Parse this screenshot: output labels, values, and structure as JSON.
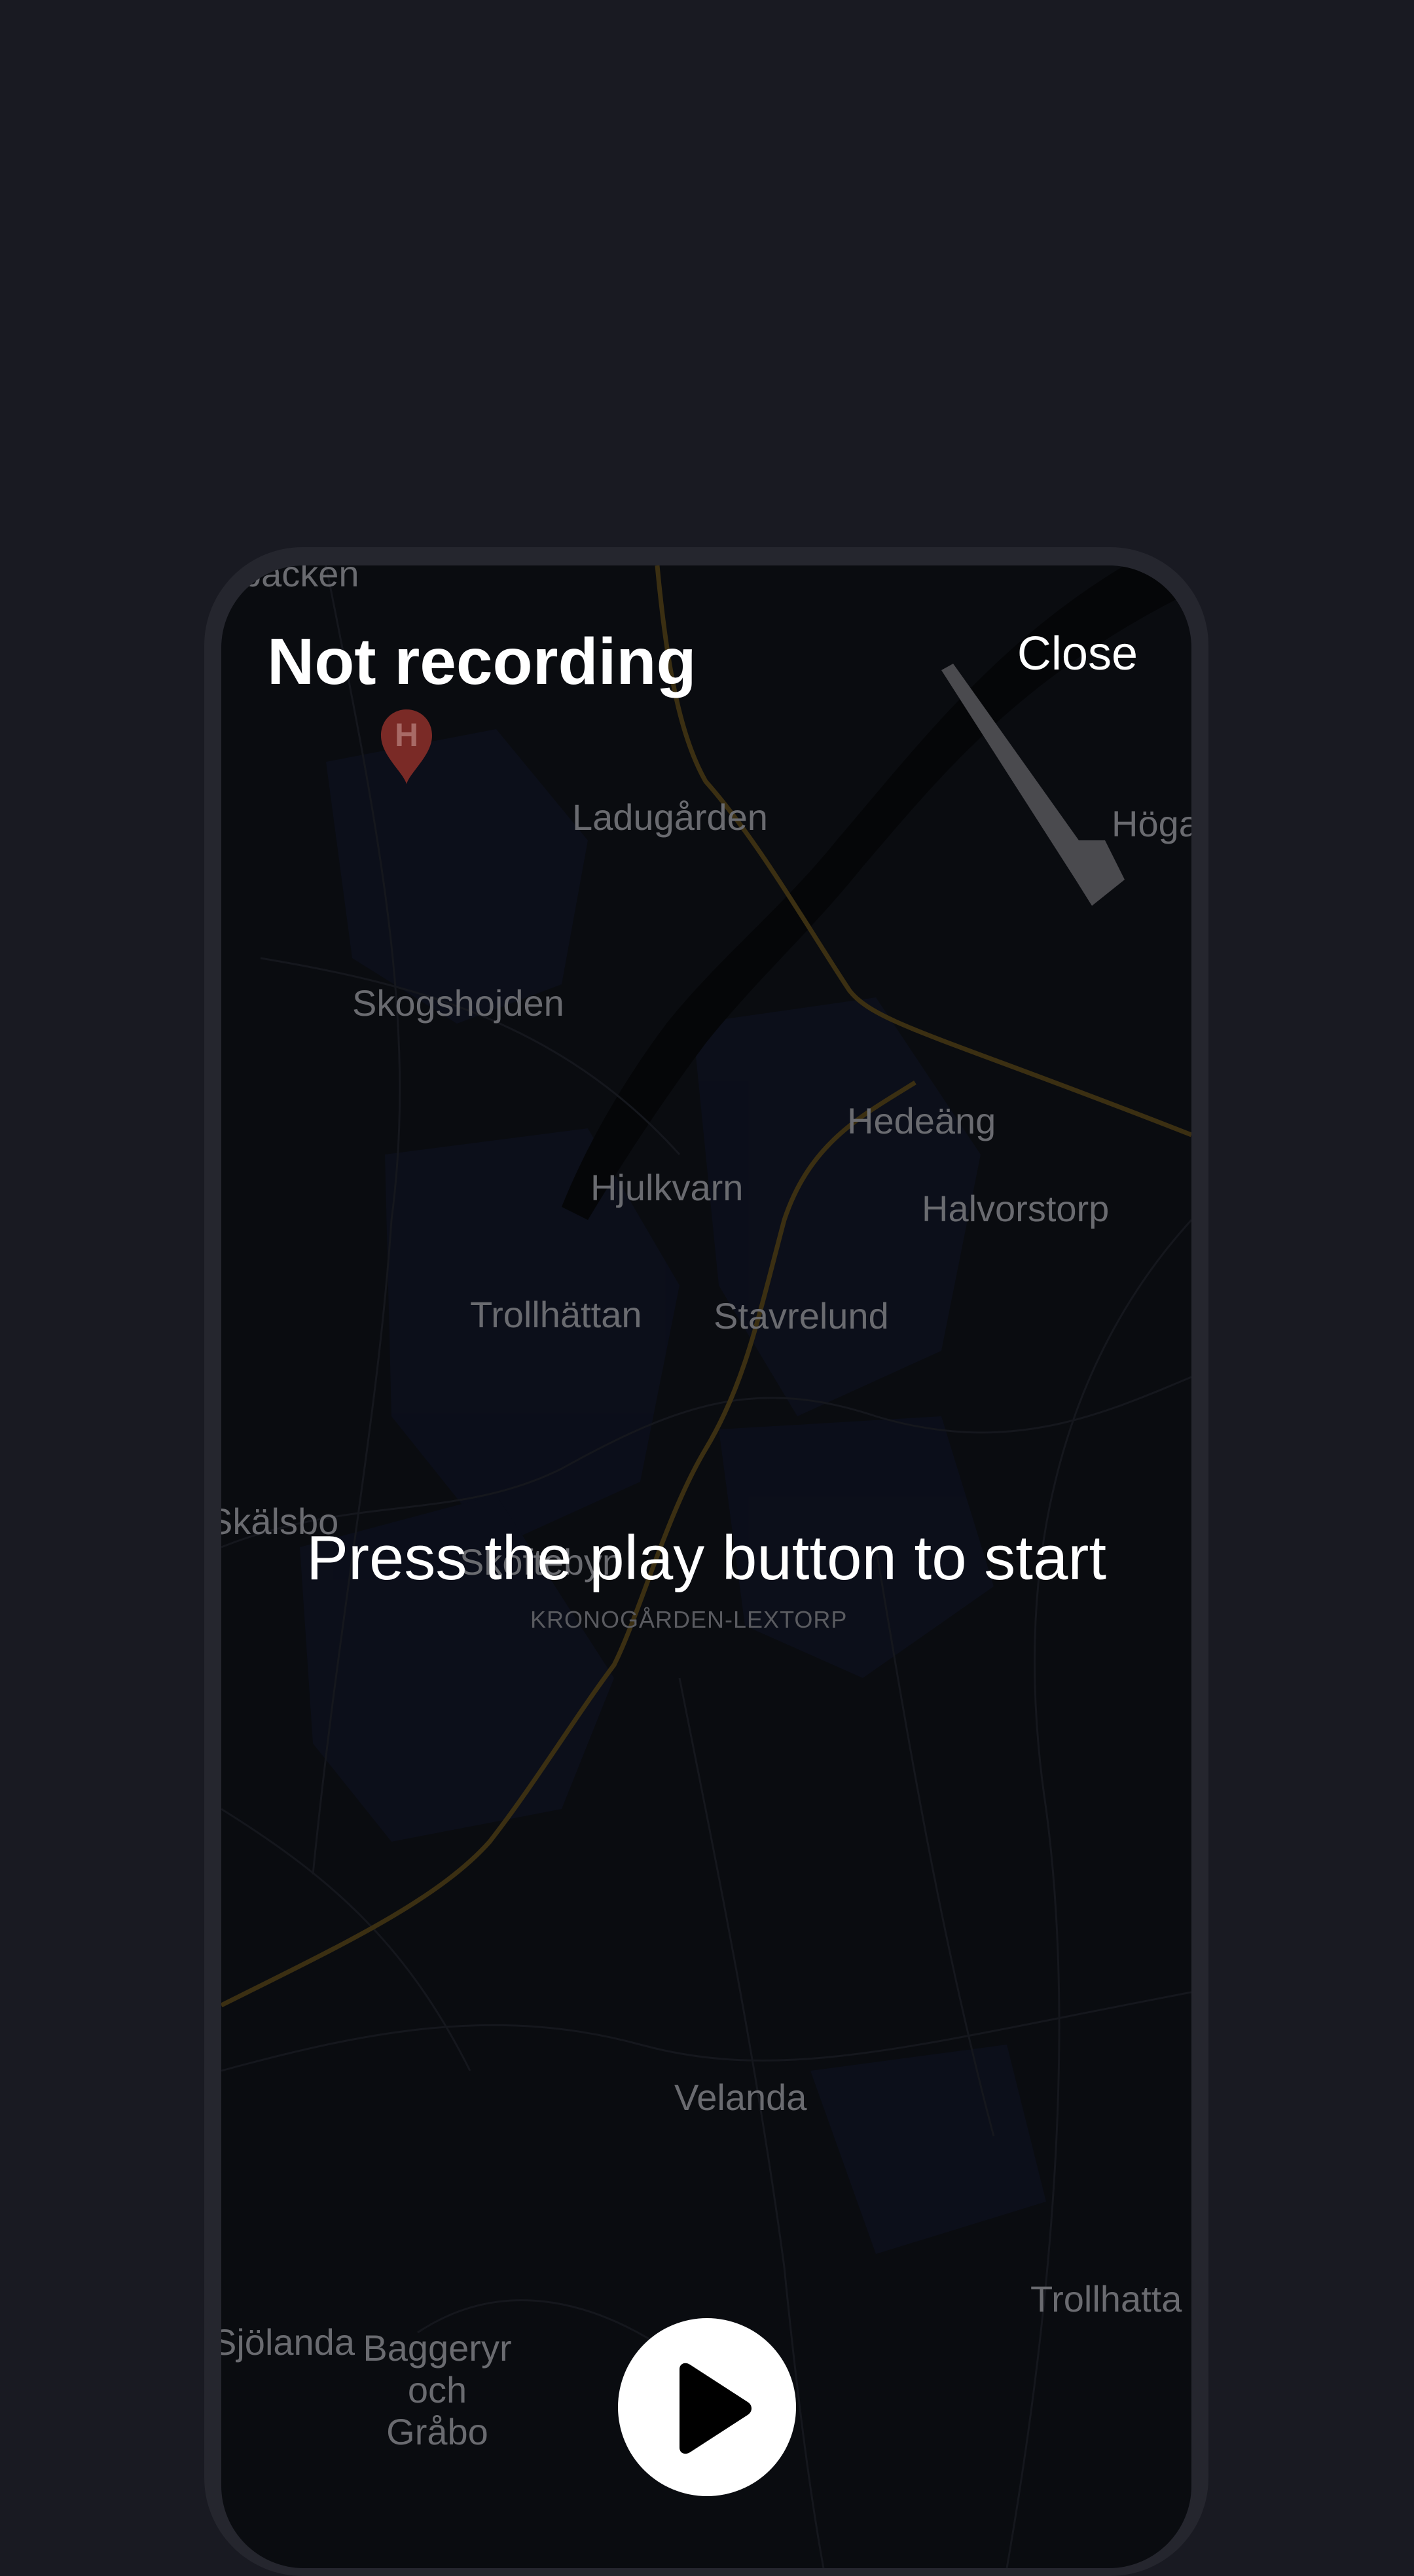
{
  "header": {
    "title": "Not recording",
    "close_label": "Close"
  },
  "hint": "Press the play button to start",
  "play_button": {
    "icon": "play-icon"
  },
  "map": {
    "places": {
      "backen": "backen",
      "ladugarden": "Ladugården",
      "hoga": "Höga",
      "skogshojden": "Skogshojden",
      "hedeang": "Hedeäng",
      "halvorstorp": "Halvorstorp",
      "hjulkvarn": "Hjulkvarn",
      "trollhattan": "Trollhättan",
      "stavrelund": "Stavrelund",
      "skalsbo": "Skälsbo",
      "skoftebyn": "Skoftebyn",
      "kronogarden": "KRONOGÅRDEN-LEXTORP",
      "velanda": "Velanda",
      "trollhatta": "Trollhatta",
      "sjolanda": "Sjölanda",
      "baggeryr": "Baggeryr och Gråbo"
    },
    "hospital_marker_letter": "H",
    "colors": {
      "background": "#0a0c10",
      "road_major": "#3b2f12",
      "water": "#06070a",
      "label": "#6a6b70"
    }
  },
  "colors": {
    "page_background": "#191a22",
    "frame": "#25262e",
    "accent": "#ffffff"
  }
}
